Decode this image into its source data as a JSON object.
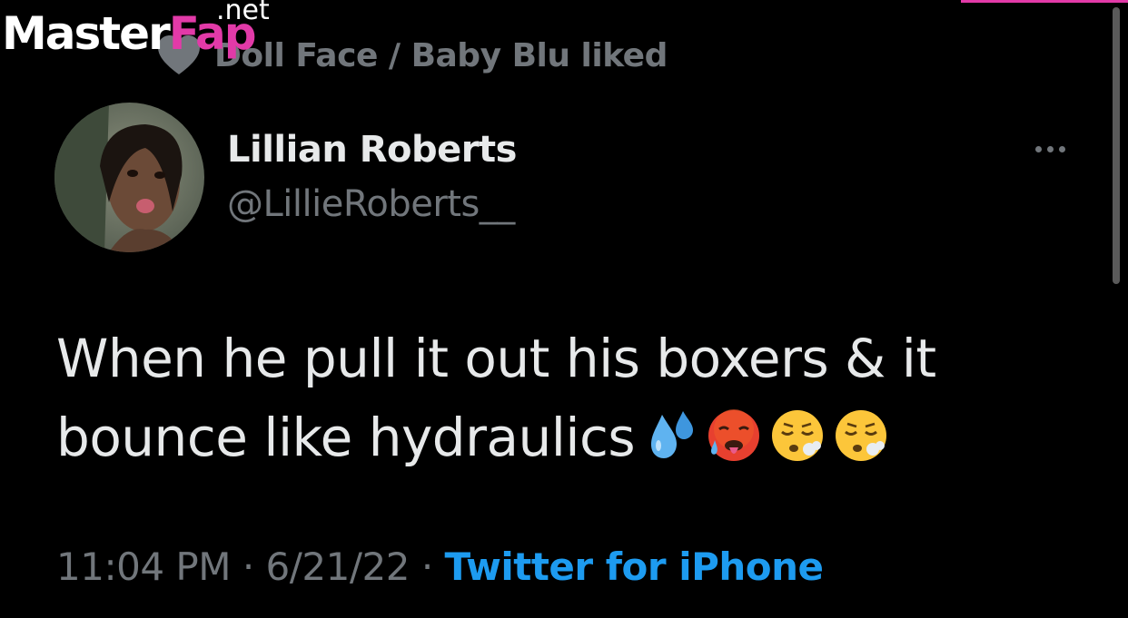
{
  "watermark": {
    "master": "Master",
    "fap": "Fap",
    "net": ".net"
  },
  "social_context": {
    "icon": "heart-icon",
    "text": "Doll Face / Baby Blu liked"
  },
  "author": {
    "display_name": "Lillian Roberts",
    "handle": "@LillieRoberts__",
    "avatar": "avatar-photo"
  },
  "more_icon": "more-horizontal-icon",
  "tweet": {
    "line1": "When he pull it out his boxers & it",
    "line2": "bounce like hydraulics",
    "emojis": [
      "sweat-droplets-emoji",
      "hot-face-emoji",
      "face-exhaling-emoji",
      "face-exhaling-emoji"
    ]
  },
  "meta": {
    "time": "11:04 PM",
    "separator": "·",
    "date": "6/21/22",
    "source": "Twitter for iPhone"
  },
  "colors": {
    "background": "#000000",
    "primary_text": "#e7e9ea",
    "secondary_text": "#71767b",
    "link": "#1d9bf0",
    "watermark_accent": "#e23aa8"
  }
}
